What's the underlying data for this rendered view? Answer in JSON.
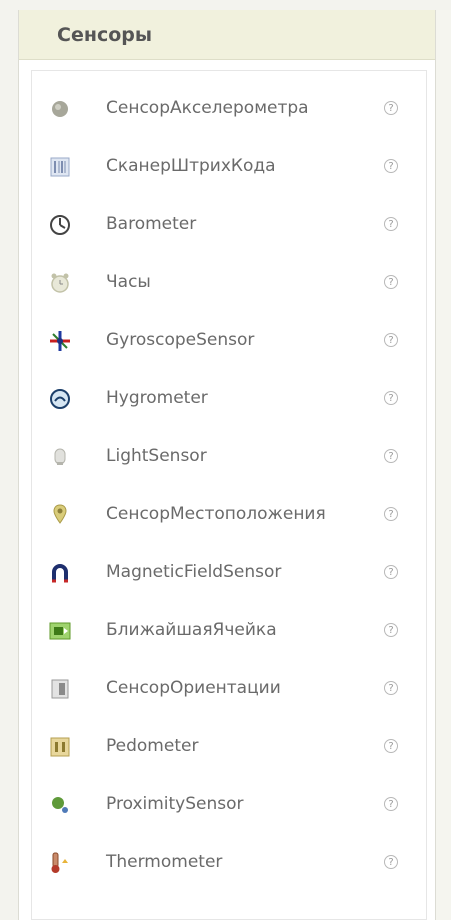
{
  "palette": {
    "header_bg": "#f1f1dd",
    "text": "#6a6a6a",
    "panel_bg": "#ffffff"
  },
  "panel": {
    "title": "Сенсоры",
    "help_glyph": "?",
    "items": [
      {
        "label": "СенсорАкселерометра",
        "icon": "accelerometer-icon"
      },
      {
        "label": "СканерШтрихКода",
        "icon": "barcode-scanner-icon"
      },
      {
        "label": "Barometer",
        "icon": "barometer-icon"
      },
      {
        "label": "Часы",
        "icon": "clock-icon"
      },
      {
        "label": "GyroscopeSensor",
        "icon": "gyroscope-icon"
      },
      {
        "label": "Hygrometer",
        "icon": "hygrometer-icon"
      },
      {
        "label": "LightSensor",
        "icon": "light-sensor-icon"
      },
      {
        "label": "СенсорМестоположения",
        "icon": "location-sensor-icon"
      },
      {
        "label": "MagneticFieldSensor",
        "icon": "magnet-icon"
      },
      {
        "label": "БлижайшаяЯчейка",
        "icon": "nearfield-icon"
      },
      {
        "label": "СенсорОриентации",
        "icon": "orientation-sensor-icon"
      },
      {
        "label": "Pedometer",
        "icon": "pedometer-icon"
      },
      {
        "label": "ProximitySensor",
        "icon": "proximity-sensor-icon"
      },
      {
        "label": "Thermometer",
        "icon": "thermometer-icon"
      }
    ]
  }
}
